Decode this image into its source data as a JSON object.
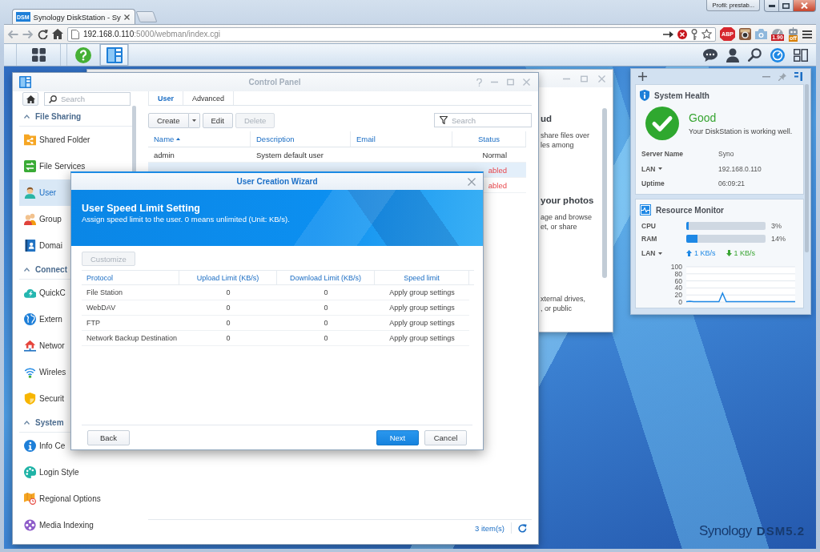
{
  "browser": {
    "favicon": "DSM",
    "tab_title": "Synology DiskStation - Sy",
    "profile": "Profil: prestab...",
    "url_host": "192.168.0.110",
    "url_path": ":5000/webman/index.cgi",
    "extensions": [
      {
        "kind": "abp",
        "label": "ABP"
      },
      {
        "kind": "photo"
      },
      {
        "kind": "camera"
      },
      {
        "kind": "gauge",
        "label": "1.90"
      },
      {
        "kind": "robot",
        "label": "off"
      }
    ]
  },
  "taskbar": {
    "apps": [
      {
        "kind": "menu",
        "selected": false
      },
      {
        "kind": "help",
        "selected": false
      },
      {
        "kind": "control_panel",
        "selected": true
      }
    ]
  },
  "background_window": {
    "sections": [
      {
        "heading": "ud",
        "lines": [
          "share files over",
          "les among"
        ]
      },
      {
        "heading": "your photos",
        "lines": [
          "age and browse",
          "et, or share"
        ]
      },
      {
        "lines": [
          "xternal drives,",
          ", or public"
        ]
      }
    ]
  },
  "control_panel": {
    "title": "Control Panel",
    "search_placeholder": "Search",
    "sidebar": [
      {
        "title": "File Sharing",
        "expanded": true,
        "items": [
          {
            "kind": "folder",
            "label": "Shared Folder",
            "selected": false
          },
          {
            "kind": "services",
            "label": "File Services",
            "selected": false
          },
          {
            "kind": "user",
            "label": "User",
            "selected": true
          },
          {
            "kind": "group",
            "label": "Group",
            "selected": false
          },
          {
            "kind": "domain",
            "label": "Domai",
            "selected": false
          }
        ]
      },
      {
        "title": "Connect",
        "expanded": true,
        "items": [
          {
            "kind": "cloud",
            "label": "QuickC",
            "selected": false
          },
          {
            "kind": "globe",
            "label": "Extern",
            "selected": false
          },
          {
            "kind": "network",
            "label": "Networ",
            "selected": false
          },
          {
            "kind": "wireless",
            "label": "Wireles",
            "selected": false
          },
          {
            "kind": "shield",
            "label": "Securit",
            "selected": false
          }
        ]
      },
      {
        "title": "System",
        "expanded": true,
        "items": [
          {
            "kind": "info",
            "label": "Info Ce",
            "selected": false
          },
          {
            "kind": "palette",
            "label": "Login Style",
            "selected": false
          },
          {
            "kind": "regional",
            "label": "Regional Options",
            "selected": false
          },
          {
            "kind": "media",
            "label": "Media Indexing",
            "selected": false
          }
        ]
      }
    ],
    "tabs": [
      {
        "label": "User",
        "selected": true
      },
      {
        "label": "Advanced",
        "selected": false
      }
    ],
    "toolbar": [
      {
        "kind": "split",
        "label": "Create",
        "disabled": false
      },
      {
        "kind": "plain",
        "label": "Edit",
        "disabled": false
      },
      {
        "kind": "plain",
        "label": "Delete",
        "disabled": true
      }
    ],
    "filter_placeholder": "Search",
    "user_table": {
      "columns": [
        {
          "label": "Name",
          "sorted": true
        },
        {
          "label": "Description",
          "sorted": false
        },
        {
          "label": "Email",
          "sorted": false
        },
        {
          "label": "Status",
          "sorted": false
        }
      ],
      "rows": [
        {
          "name": "admin",
          "description": "System default user",
          "status": "Normal",
          "disabled": false,
          "selected": false
        },
        {
          "status": "abled",
          "disabled": true,
          "selected": true
        },
        {
          "status": "abled",
          "disabled": true,
          "selected": false
        }
      ]
    },
    "item_count": "3 item(s)"
  },
  "wizard": {
    "title": "User Creation Wizard",
    "heading": "User Speed Limit Setting",
    "description": "Assign speed limit to the user. 0 means unlimited (Unit: KB/s).",
    "customize": {
      "label": "Customize",
      "disabled": true
    },
    "columns": [
      "Protocol",
      "Upload Limit (KB/s)",
      "Download Limit (KB/s)",
      "Speed limit"
    ],
    "rows": [
      [
        "File Station",
        "0",
        "0",
        "Apply group settings"
      ],
      [
        "WebDAV",
        "0",
        "0",
        "Apply group settings"
      ],
      [
        "FTP",
        "0",
        "0",
        "Apply group settings"
      ],
      [
        "Network Backup Destination",
        "0",
        "0",
        "Apply group settings"
      ]
    ],
    "buttons": [
      {
        "kind": "secondary",
        "label": "Back"
      },
      {
        "kind": "primary",
        "label": "Next"
      },
      {
        "kind": "secondary",
        "label": "Cancel"
      }
    ]
  },
  "widgets": {
    "health": {
      "title": "System Health",
      "status": "Good",
      "message": "Your DiskStation is working well.",
      "info": [
        {
          "label": "Server Name",
          "value": "Syno",
          "dropdown": false
        },
        {
          "label": "LAN",
          "value": "192.168.0.110",
          "dropdown": true
        },
        {
          "label": "Uptime",
          "value": "06:09:21",
          "dropdown": false
        }
      ]
    },
    "resource": {
      "title": "Resource Monitor",
      "meters": [
        {
          "label": "CPU",
          "level": 0.03,
          "reading": "3%"
        },
        {
          "label": "RAM",
          "level": 0.14,
          "reading": "14%"
        }
      ],
      "network": {
        "label": "LAN",
        "upload": "1 KB/s",
        "download": "1 KB/s"
      },
      "chart_data": {
        "type": "line",
        "grid": true,
        "ylim": [
          0,
          100
        ],
        "yticks": [
          0,
          20,
          40,
          60,
          80,
          100
        ],
        "series": [
          {
            "color": "#1e88e5",
            "values": [
              1,
              2,
              1,
              1,
              1,
              1,
              1,
              1,
              1,
              1,
              25,
              1,
              1,
              1,
              1,
              1,
              1,
              1,
              1,
              1,
              1,
              1,
              1,
              1,
              1,
              1,
              1,
              1,
              1,
              1,
              1
            ]
          }
        ]
      }
    }
  },
  "desktop": {
    "brand": "Synology",
    "version": "DSM5.2"
  }
}
